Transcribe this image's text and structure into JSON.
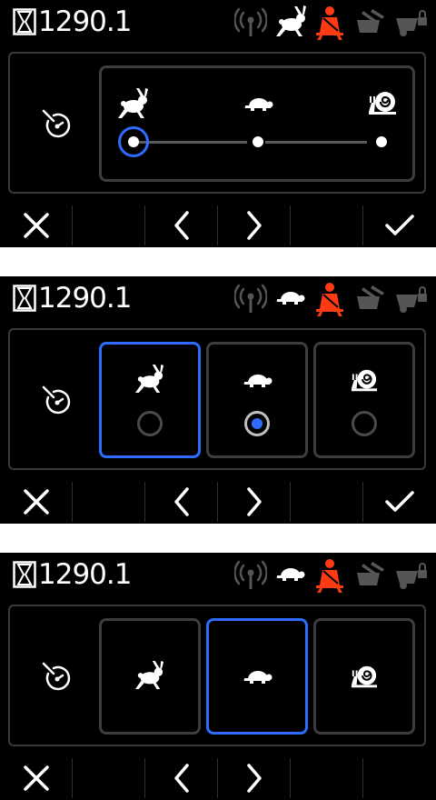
{
  "colors": {
    "background": "#000000",
    "accent_blue": "#2f6bff",
    "warning_red": "#ff3b14",
    "inactive_gray": "#3d3d3d"
  },
  "status": {
    "hours": "1290.1",
    "icons": [
      "hourglass-icon",
      "signal-icon",
      "rabbit-icon",
      "seatbelt-icon",
      "seat-icon",
      "locked-vehicle-icon"
    ]
  },
  "screens": [
    {
      "status_speed_icon": "rabbit-icon",
      "layout": "slider",
      "options": [
        "rabbit",
        "turtle",
        "snail"
      ],
      "selected_index": 0,
      "show_confirm": true
    },
    {
      "status_speed_icon": "turtle-icon",
      "layout": "cards-with-radio",
      "options": [
        "rabbit",
        "turtle",
        "snail"
      ],
      "focused_index": 0,
      "selected_index": 1,
      "show_confirm": true
    },
    {
      "status_speed_icon": "turtle-icon",
      "layout": "cards",
      "options": [
        "rabbit",
        "turtle",
        "snail"
      ],
      "focused_index": 1,
      "show_confirm": false
    }
  ],
  "nav": {
    "buttons": [
      "close-icon",
      "chevron-left-icon",
      "chevron-right-icon",
      "check-icon"
    ]
  }
}
